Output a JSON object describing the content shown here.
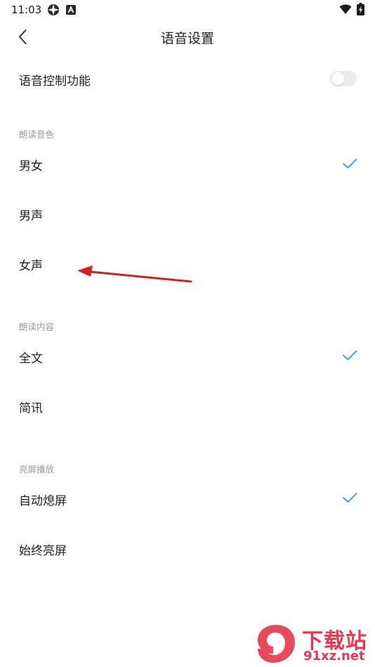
{
  "status_bar": {
    "time": "11:03",
    "icons": [
      "settings-gear-icon",
      "notification-a-icon",
      "wifi-icon",
      "battery-charging-icon"
    ]
  },
  "header": {
    "title": "语音设置",
    "back_icon": "chevron-left-icon"
  },
  "voice_control": {
    "label": "语音控制功能",
    "enabled": false
  },
  "sections": {
    "voice_type": {
      "header": "朗读音色",
      "options": [
        "男女",
        "男声",
        "女声"
      ],
      "selected": "男女"
    },
    "read_content": {
      "header": "朗读内容",
      "options": [
        "全文",
        "简讯"
      ],
      "selected": "全文"
    },
    "screen": {
      "header": "亮屏播放",
      "options": [
        "自动熄屏",
        "始终亮屏"
      ],
      "selected": "自动熄屏"
    }
  },
  "colors": {
    "accent": "#3d8fe6",
    "annotation_arrow": "#d42020",
    "watermark": "#e8384f"
  },
  "watermark": {
    "brand": "下载站",
    "domain": "91xz.net"
  }
}
